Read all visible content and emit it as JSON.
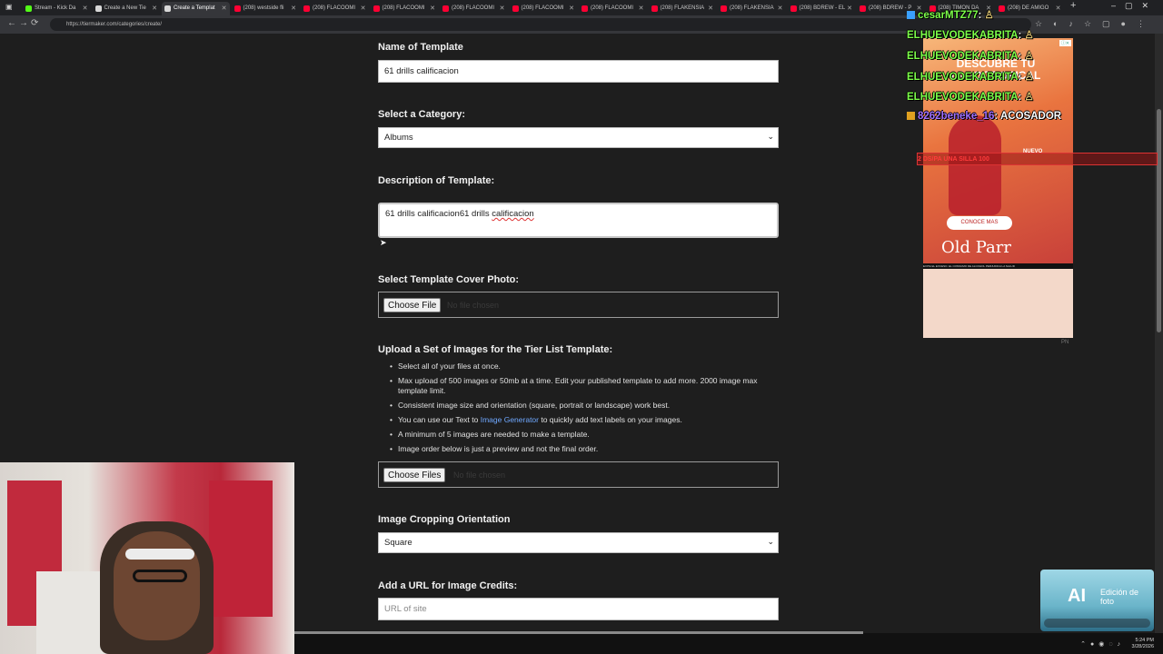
{
  "browser": {
    "tabs": [
      {
        "label": "Stream - Kick Da",
        "favicon_color": "#53fc18"
      },
      {
        "label": "Create a New Tie",
        "favicon_color": "#d8d8d8"
      },
      {
        "label": "Create a Templat",
        "favicon_color": "#d8d8d8"
      },
      {
        "label": "(208) westside fli",
        "favicon_color": "#ff0033"
      },
      {
        "label": "(208) FLACOOMI",
        "favicon_color": "#ff0033"
      },
      {
        "label": "(208) FLACOOMI",
        "favicon_color": "#ff0033"
      },
      {
        "label": "(208) FLACOOMI",
        "favicon_color": "#ff0033"
      },
      {
        "label": "(208) FLACOOMI",
        "favicon_color": "#ff0033"
      },
      {
        "label": "(208) FLACOOMI",
        "favicon_color": "#ff0033"
      },
      {
        "label": "(208) FLAKENSIA",
        "favicon_color": "#ff0033"
      },
      {
        "label": "(208) FLAKENSIA",
        "favicon_color": "#ff0033"
      },
      {
        "label": "(208) BDREW - EL",
        "favicon_color": "#ff0033"
      },
      {
        "label": "(208) BDREW - P",
        "favicon_color": "#ff0033"
      },
      {
        "label": "(208) TIMON DA",
        "favicon_color": "#ff0033"
      },
      {
        "label": "(208) DE AMIGO",
        "favicon_color": "#ff0033"
      }
    ],
    "active_tab": 2,
    "url": "https://tiermaker.com/categories/create/"
  },
  "form": {
    "name_label": "Name of Template",
    "name_value": "61  drills calificacion",
    "category_label": "Select a Category:",
    "category_value": "Albums",
    "description_label": "Description of Template:",
    "description_value_a": "61  drills calificacion61  drills ",
    "description_value_b": "calificacion",
    "cover_label": "Select Template Cover Photo:",
    "cover_button": "Choose File",
    "cover_status": "No file chosen",
    "upload_label": "Upload a Set of Images for the Tier List Template:",
    "bullets": {
      "b1": "Select all of your files at once.",
      "b2": "Max upload of 500 images or 50mb at a time. Edit your published template to add more. 2000 image max template limit.",
      "b3": "Consistent image size and orientation (square, portrait or landscape) work best.",
      "b4_pre": "You can use our Text to ",
      "b4_link": "Image Generator",
      "b4_post": " to quickly add text labels on your images.",
      "b5": "A minimum of 5 images are needed to make a template.",
      "b6": "Image order below is just a preview and not the final order."
    },
    "images_button": "Choose Files",
    "images_status": "No file chosen",
    "crop_label": "Image Cropping Orientation",
    "crop_value": "Square",
    "url_label": "Add a URL for Image Credits:",
    "url_placeholder": "URL of site"
  },
  "chat": [
    {
      "user": "cesarMTZ77",
      "msg": ":"
    },
    {
      "user": "ELHUEVODEKABRITA",
      "msg": ":"
    },
    {
      "user": "ELHUEVODEKABRITA",
      "msg": ":"
    },
    {
      "user": "ELHUEVODEKABRITA",
      "msg": ":"
    },
    {
      "user": "ELHUEVODEKABRITA",
      "msg": ":"
    },
    {
      "user": "8262beneke_16",
      "msg": ": ACOSADOR"
    }
  ],
  "red_banner": "2                  DS/PA UNA SILLA                              100",
  "ad": {
    "headline": "DESCUBRE TU LADO TROPICAL",
    "tag": "NUEVO",
    "cta": "CONOCE MAS",
    "brand": "Old Parr",
    "legal": "EVITE EL EXCESO. EL CONSUMO DE ALCOHOL PERJUDICA LA SALUD",
    "corner": "PN"
  },
  "toast": {
    "ai": "AI",
    "text": "Edición de foto"
  },
  "taskbar": {
    "time": "5:24 PM",
    "date": "3/28/2026"
  }
}
